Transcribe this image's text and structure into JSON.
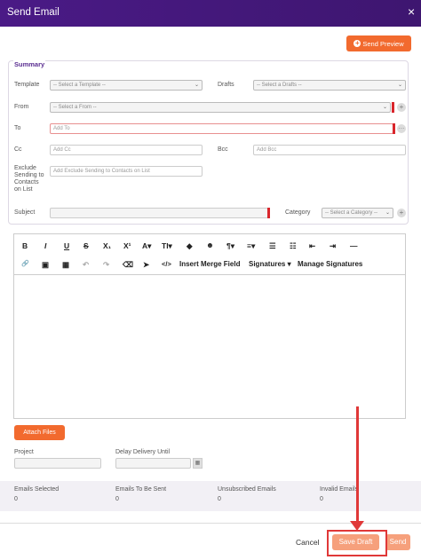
{
  "window": {
    "title": "Send Email",
    "close": "×"
  },
  "actions": {
    "send_preview": "Send Preview",
    "attach_files": "Attach Files",
    "cancel": "Cancel",
    "save_draft": "Save Draft",
    "send": "Send"
  },
  "summary": {
    "title": "Summary",
    "template": {
      "label": "Template",
      "value": "-- Select a Template --"
    },
    "drafts": {
      "label": "Drafts",
      "value": "-- Select a Drafts --"
    },
    "from": {
      "label": "From",
      "value": "-- Select a From --"
    },
    "to": {
      "label": "To",
      "placeholder": "Add To"
    },
    "cc": {
      "label": "Cc",
      "placeholder": "Add Cc"
    },
    "bcc": {
      "label": "Bcc",
      "placeholder": "Add Bcc"
    },
    "exclude": {
      "label_lines": [
        "Exclude",
        "Sending to",
        "Contacts",
        "on List"
      ],
      "placeholder": "Add Exclude Sending to Contacts on List"
    },
    "subject": {
      "label": "Subject",
      "value": ""
    },
    "category": {
      "label": "Category",
      "value": "-- Select a Category --"
    }
  },
  "toolbar": {
    "row1": [
      "B",
      "I",
      "U",
      "S",
      "X₁",
      "X¹",
      "A▾",
      "TI▾",
      "◆",
      "☻",
      "¶▾",
      "≡▾",
      "☰",
      "☷",
      "⇤",
      "⇥",
      "—"
    ],
    "row1_names": [
      "bold-icon",
      "italic-icon",
      "underline-icon",
      "strikethrough-icon",
      "subscript-icon",
      "superscript-icon",
      "font-color-icon",
      "font-size-icon",
      "fill-color-icon",
      "emoji-icon",
      "paragraph-format-icon",
      "align-icon",
      "ordered-list-icon",
      "unordered-list-icon",
      "outdent-icon",
      "indent-icon",
      "horizontal-line-icon"
    ],
    "row2_icons": [
      "🔗",
      "▣",
      "▦",
      "↶",
      "↷",
      "⌫",
      "➤",
      "</>"
    ],
    "row2_names": [
      "link-icon",
      "image-icon",
      "table-icon",
      "undo-icon",
      "redo-icon",
      "clear-format-icon",
      "select-icon",
      "code-view-icon"
    ],
    "insert_merge_field": "Insert Merge Field",
    "signatures": "Signatures ▾",
    "manage_signatures": "Manage Signatures"
  },
  "fields": {
    "project": {
      "label": "Project",
      "value": ""
    },
    "delay": {
      "label": "Delay Delivery Until",
      "value": ""
    }
  },
  "stats": [
    {
      "label": "Emails Selected",
      "value": "0"
    },
    {
      "label": "Emails To Be Sent",
      "value": "0"
    },
    {
      "label": "Unsubscribed Emails",
      "value": "0"
    },
    {
      "label": "Invalid Emails",
      "value": "0"
    }
  ],
  "colors": {
    "header": "#4a1a86",
    "accent": "#f26a2e",
    "annotation": "#e03838"
  }
}
